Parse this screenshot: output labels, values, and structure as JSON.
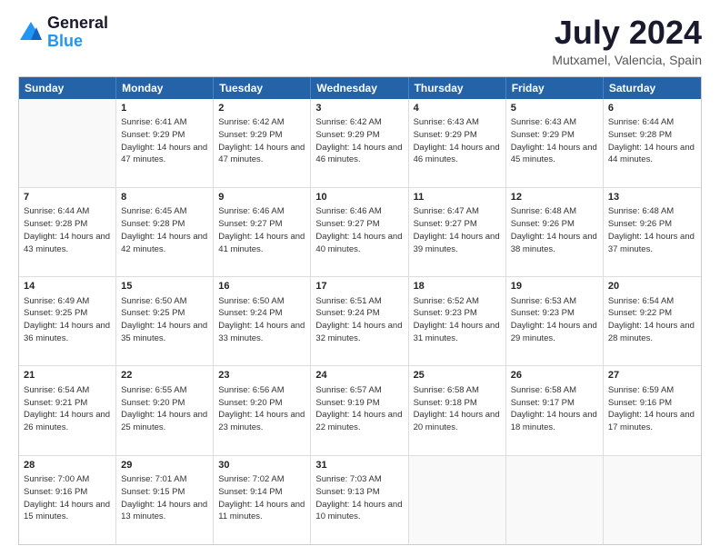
{
  "logo": {
    "text1": "General",
    "text2": "Blue"
  },
  "title": {
    "month_year": "July 2024",
    "location": "Mutxamel, Valencia, Spain"
  },
  "header_days": [
    "Sunday",
    "Monday",
    "Tuesday",
    "Wednesday",
    "Thursday",
    "Friday",
    "Saturday"
  ],
  "weeks": [
    [
      {
        "day": "",
        "sunrise": "",
        "sunset": "",
        "daylight": ""
      },
      {
        "day": "1",
        "sunrise": "Sunrise: 6:41 AM",
        "sunset": "Sunset: 9:29 PM",
        "daylight": "Daylight: 14 hours and 47 minutes."
      },
      {
        "day": "2",
        "sunrise": "Sunrise: 6:42 AM",
        "sunset": "Sunset: 9:29 PM",
        "daylight": "Daylight: 14 hours and 47 minutes."
      },
      {
        "day": "3",
        "sunrise": "Sunrise: 6:42 AM",
        "sunset": "Sunset: 9:29 PM",
        "daylight": "Daylight: 14 hours and 46 minutes."
      },
      {
        "day": "4",
        "sunrise": "Sunrise: 6:43 AM",
        "sunset": "Sunset: 9:29 PM",
        "daylight": "Daylight: 14 hours and 46 minutes."
      },
      {
        "day": "5",
        "sunrise": "Sunrise: 6:43 AM",
        "sunset": "Sunset: 9:29 PM",
        "daylight": "Daylight: 14 hours and 45 minutes."
      },
      {
        "day": "6",
        "sunrise": "Sunrise: 6:44 AM",
        "sunset": "Sunset: 9:28 PM",
        "daylight": "Daylight: 14 hours and 44 minutes."
      }
    ],
    [
      {
        "day": "7",
        "sunrise": "Sunrise: 6:44 AM",
        "sunset": "Sunset: 9:28 PM",
        "daylight": "Daylight: 14 hours and 43 minutes."
      },
      {
        "day": "8",
        "sunrise": "Sunrise: 6:45 AM",
        "sunset": "Sunset: 9:28 PM",
        "daylight": "Daylight: 14 hours and 42 minutes."
      },
      {
        "day": "9",
        "sunrise": "Sunrise: 6:46 AM",
        "sunset": "Sunset: 9:27 PM",
        "daylight": "Daylight: 14 hours and 41 minutes."
      },
      {
        "day": "10",
        "sunrise": "Sunrise: 6:46 AM",
        "sunset": "Sunset: 9:27 PM",
        "daylight": "Daylight: 14 hours and 40 minutes."
      },
      {
        "day": "11",
        "sunrise": "Sunrise: 6:47 AM",
        "sunset": "Sunset: 9:27 PM",
        "daylight": "Daylight: 14 hours and 39 minutes."
      },
      {
        "day": "12",
        "sunrise": "Sunrise: 6:48 AM",
        "sunset": "Sunset: 9:26 PM",
        "daylight": "Daylight: 14 hours and 38 minutes."
      },
      {
        "day": "13",
        "sunrise": "Sunrise: 6:48 AM",
        "sunset": "Sunset: 9:26 PM",
        "daylight": "Daylight: 14 hours and 37 minutes."
      }
    ],
    [
      {
        "day": "14",
        "sunrise": "Sunrise: 6:49 AM",
        "sunset": "Sunset: 9:25 PM",
        "daylight": "Daylight: 14 hours and 36 minutes."
      },
      {
        "day": "15",
        "sunrise": "Sunrise: 6:50 AM",
        "sunset": "Sunset: 9:25 PM",
        "daylight": "Daylight: 14 hours and 35 minutes."
      },
      {
        "day": "16",
        "sunrise": "Sunrise: 6:50 AM",
        "sunset": "Sunset: 9:24 PM",
        "daylight": "Daylight: 14 hours and 33 minutes."
      },
      {
        "day": "17",
        "sunrise": "Sunrise: 6:51 AM",
        "sunset": "Sunset: 9:24 PM",
        "daylight": "Daylight: 14 hours and 32 minutes."
      },
      {
        "day": "18",
        "sunrise": "Sunrise: 6:52 AM",
        "sunset": "Sunset: 9:23 PM",
        "daylight": "Daylight: 14 hours and 31 minutes."
      },
      {
        "day": "19",
        "sunrise": "Sunrise: 6:53 AM",
        "sunset": "Sunset: 9:23 PM",
        "daylight": "Daylight: 14 hours and 29 minutes."
      },
      {
        "day": "20",
        "sunrise": "Sunrise: 6:54 AM",
        "sunset": "Sunset: 9:22 PM",
        "daylight": "Daylight: 14 hours and 28 minutes."
      }
    ],
    [
      {
        "day": "21",
        "sunrise": "Sunrise: 6:54 AM",
        "sunset": "Sunset: 9:21 PM",
        "daylight": "Daylight: 14 hours and 26 minutes."
      },
      {
        "day": "22",
        "sunrise": "Sunrise: 6:55 AM",
        "sunset": "Sunset: 9:20 PM",
        "daylight": "Daylight: 14 hours and 25 minutes."
      },
      {
        "day": "23",
        "sunrise": "Sunrise: 6:56 AM",
        "sunset": "Sunset: 9:20 PM",
        "daylight": "Daylight: 14 hours and 23 minutes."
      },
      {
        "day": "24",
        "sunrise": "Sunrise: 6:57 AM",
        "sunset": "Sunset: 9:19 PM",
        "daylight": "Daylight: 14 hours and 22 minutes."
      },
      {
        "day": "25",
        "sunrise": "Sunrise: 6:58 AM",
        "sunset": "Sunset: 9:18 PM",
        "daylight": "Daylight: 14 hours and 20 minutes."
      },
      {
        "day": "26",
        "sunrise": "Sunrise: 6:58 AM",
        "sunset": "Sunset: 9:17 PM",
        "daylight": "Daylight: 14 hours and 18 minutes."
      },
      {
        "day": "27",
        "sunrise": "Sunrise: 6:59 AM",
        "sunset": "Sunset: 9:16 PM",
        "daylight": "Daylight: 14 hours and 17 minutes."
      }
    ],
    [
      {
        "day": "28",
        "sunrise": "Sunrise: 7:00 AM",
        "sunset": "Sunset: 9:16 PM",
        "daylight": "Daylight: 14 hours and 15 minutes."
      },
      {
        "day": "29",
        "sunrise": "Sunrise: 7:01 AM",
        "sunset": "Sunset: 9:15 PM",
        "daylight": "Daylight: 14 hours and 13 minutes."
      },
      {
        "day": "30",
        "sunrise": "Sunrise: 7:02 AM",
        "sunset": "Sunset: 9:14 PM",
        "daylight": "Daylight: 14 hours and 11 minutes."
      },
      {
        "day": "31",
        "sunrise": "Sunrise: 7:03 AM",
        "sunset": "Sunset: 9:13 PM",
        "daylight": "Daylight: 14 hours and 10 minutes."
      },
      {
        "day": "",
        "sunrise": "",
        "sunset": "",
        "daylight": ""
      },
      {
        "day": "",
        "sunrise": "",
        "sunset": "",
        "daylight": ""
      },
      {
        "day": "",
        "sunrise": "",
        "sunset": "",
        "daylight": ""
      }
    ]
  ]
}
